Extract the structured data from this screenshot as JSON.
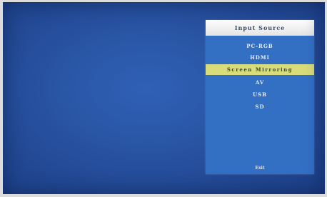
{
  "menu": {
    "title": "Input Source",
    "items": [
      {
        "label": "PC-RGB"
      },
      {
        "label": "HDMI"
      },
      {
        "label": "Screen Mirroring"
      },
      {
        "label": "AV"
      },
      {
        "label": "USB"
      },
      {
        "label": "SD"
      }
    ],
    "selected_index": 2,
    "footer": "Exit"
  },
  "colors": {
    "background": "#2a56a6",
    "menu_panel": "#3370c4",
    "header": "#f2f2f2",
    "selection_highlight": "#d8dc7a"
  }
}
